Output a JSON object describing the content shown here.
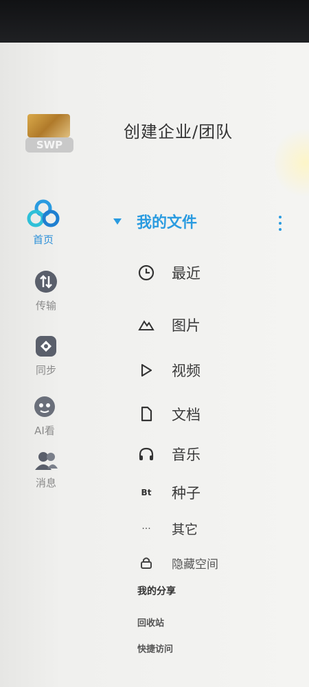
{
  "header": {
    "create_team": "创建企业/团队",
    "avatar_badge": "SWP"
  },
  "rail": {
    "home": "首页",
    "transfer": "传输",
    "sync": "同步",
    "ai": "AI看",
    "friends": "消息"
  },
  "tree": {
    "root": "我的文件",
    "items": [
      {
        "icon": "clock-icon",
        "label": "最近"
      },
      {
        "icon": "image-icon",
        "label": "图片"
      },
      {
        "icon": "play-icon",
        "label": "视频"
      },
      {
        "icon": "document-icon",
        "label": "文档"
      },
      {
        "icon": "headphones-icon",
        "label": "音乐"
      },
      {
        "icon": "bt-icon",
        "label": "种子",
        "icon_text": "Bt"
      },
      {
        "icon": "more-icon",
        "label": "其它",
        "icon_text": "···"
      },
      {
        "icon": "lock-icon",
        "label": "隐藏空间"
      }
    ]
  },
  "links": {
    "my_share": "我的分享",
    "recycle": "回收站",
    "quick_access": "快捷访问"
  },
  "colors": {
    "accent": "#2a9be0",
    "text": "#3a3a3a",
    "muted": "#8a8a8a"
  }
}
